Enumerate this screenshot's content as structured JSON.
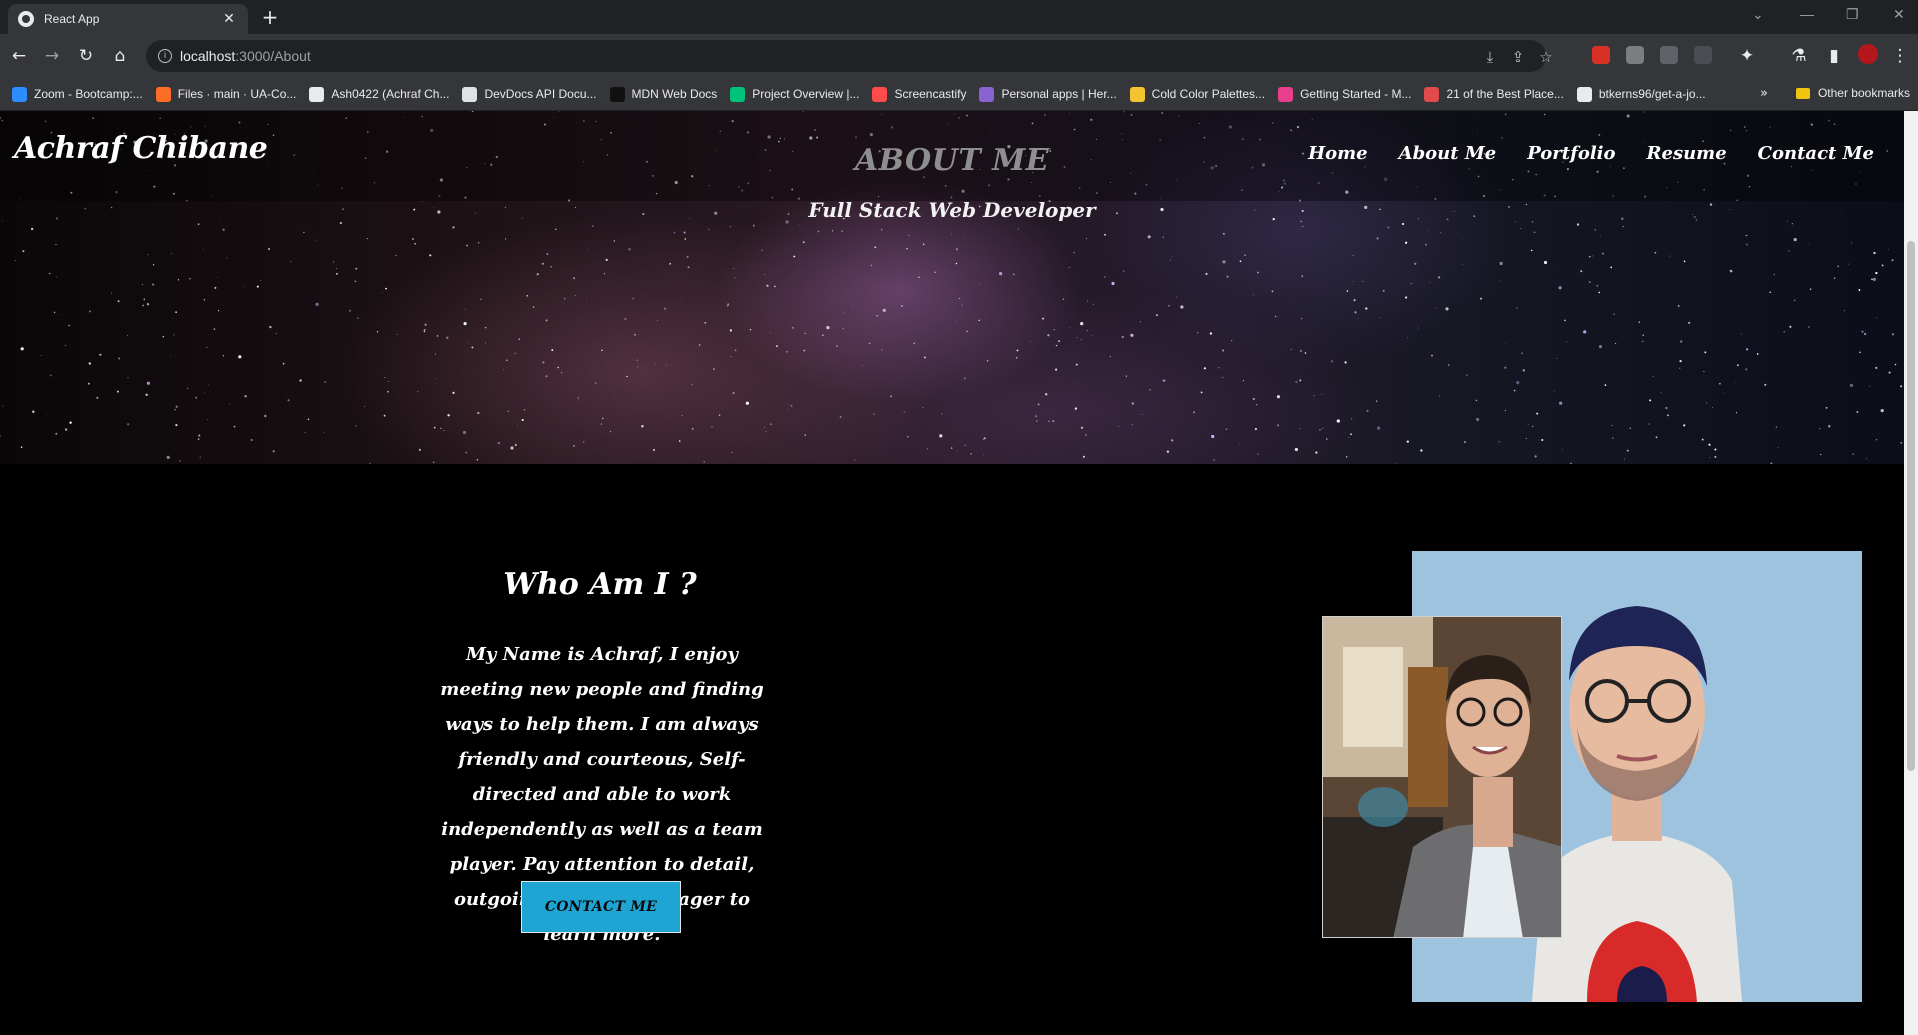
{
  "browser": {
    "tab_title": "React App",
    "tab_close": "✕",
    "new_tab": "+",
    "url_host": "localhost",
    "url_path": ":3000/About",
    "window_controls": {
      "minimize": "—",
      "restore": "❐",
      "close": "✕",
      "tabsearch": "⌄"
    }
  },
  "bookmarks": [
    {
      "label": "Zoom - Bootcamp:...",
      "color": "#2d8cff"
    },
    {
      "label": "Files · main · UA-Co...",
      "color": "#fc6d26"
    },
    {
      "label": "Ash0422 (Achraf Ch...",
      "color": "#e8eaed"
    },
    {
      "label": "DevDocs API Docu...",
      "color": "#dfe1e5"
    },
    {
      "label": "MDN Web Docs",
      "color": "#111111"
    },
    {
      "label": "Project Overview |...",
      "color": "#00c37a"
    },
    {
      "label": "Screencastify",
      "color": "#ff4b4b"
    },
    {
      "label": "Personal apps | Her...",
      "color": "#8a63d2"
    },
    {
      "label": "Cold Color Palettes...",
      "color": "#f4c430"
    },
    {
      "label": "Getting Started - M...",
      "color": "#e83e8c"
    },
    {
      "label": "21 of the Best Place...",
      "color": "#e04a4a"
    },
    {
      "label": "btkerns96/get-a-jo...",
      "color": "#e8eaed"
    }
  ],
  "bookmarks_more": "»",
  "other_bookmarks": "Other bookmarks",
  "site": {
    "brand": "Achraf Chibane",
    "heading": "ABOUT ME",
    "subheading": "Full Stack Web Developer",
    "nav": [
      "Home",
      "About Me",
      "Portfolio",
      "Resume",
      "Contact Me"
    ],
    "who_title": "Who Am I ?",
    "bio": "My Name is Achraf, I enjoy meeting new people and finding ways to help them. I am always friendly and courteous, Self-directed and able to work independently as well as a team player. Pay attention to detail, outgoing and always eager to learn more.",
    "contact_button": "CONTACT ME"
  },
  "colors": {
    "accent_button": "#1ea5d4",
    "heading_gray": "#8e8e8e",
    "portrait_background": "#9dc3df"
  }
}
